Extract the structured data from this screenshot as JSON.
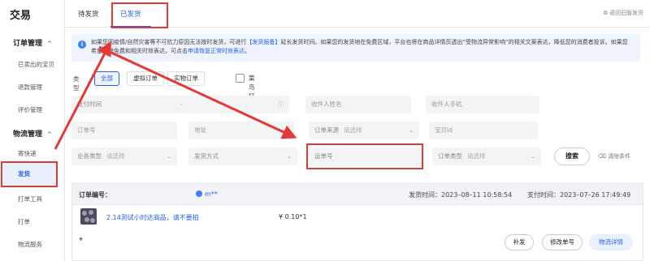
{
  "sidebar": {
    "title": "交易",
    "groups": [
      {
        "label": "订单管理",
        "chevron": "^",
        "items": [
          "已卖出的宝贝",
          "退款管理",
          "评价管理"
        ]
      },
      {
        "label": "物流管理",
        "chevron": "^",
        "items": [
          "寄快递",
          "发货",
          "打单工具",
          "打单",
          "物流服务"
        ]
      }
    ]
  },
  "tabs": {
    "items": [
      "待发货",
      "已发货"
    ],
    "active": "已发货",
    "legacy_link": "返回旧版发货"
  },
  "notice": {
    "text_1": "如果您因疫情/自然灾害等不可抗力原因无法按时发货，可进行",
    "link_1": "【发货报备】",
    "text_2": "延长发货时间。如果您的发货地在免费区域，平台也将在商品详情页透出“受物流异常影响”的相关文案表达，降低您的消费者",
    "text_3": "投诉。如果您希望取消免费和相关时效表达，可点击",
    "link_2": "申请恢复正常时效表达",
    "text_4": "。"
  },
  "filters": {
    "type_label": "类型",
    "type_options": [
      "全部",
      "虚拟订单",
      "实物订单"
    ],
    "type_selected": "全部",
    "cainiao_label": "菜鸟打单",
    "pay_time": "支付时间",
    "pay_time_sep": "-",
    "receiver_name": "收件人姓名",
    "receiver_phone": "收件人手机",
    "order_no": "订单号",
    "address": "地址",
    "order_source_label": "订单来源",
    "order_source_ph": "请选择",
    "item_id": "宝贝id",
    "biz_type_label": "业务类型",
    "biz_type_ph": "请选择",
    "ship_method": "发货方式",
    "waybill_no": "运单号",
    "order_type_label": "订单类型",
    "order_type_ph": "请选择",
    "search_button": "搜索",
    "clear_button": "清除条件"
  },
  "order": {
    "id_label": "订单编号：",
    "buyer": "m**",
    "ship_time": "发货时间：2023–08–11 10:58:54",
    "pay_time": "支付时间：2023–07–26 17:49:49",
    "product_name": "2.14测试小时达商品，请不要拍",
    "price": "¥ 0.10*1",
    "buttons": [
      "补发",
      "修改单号",
      "物流详情"
    ]
  },
  "annotation": {
    "color": "#e53935"
  }
}
